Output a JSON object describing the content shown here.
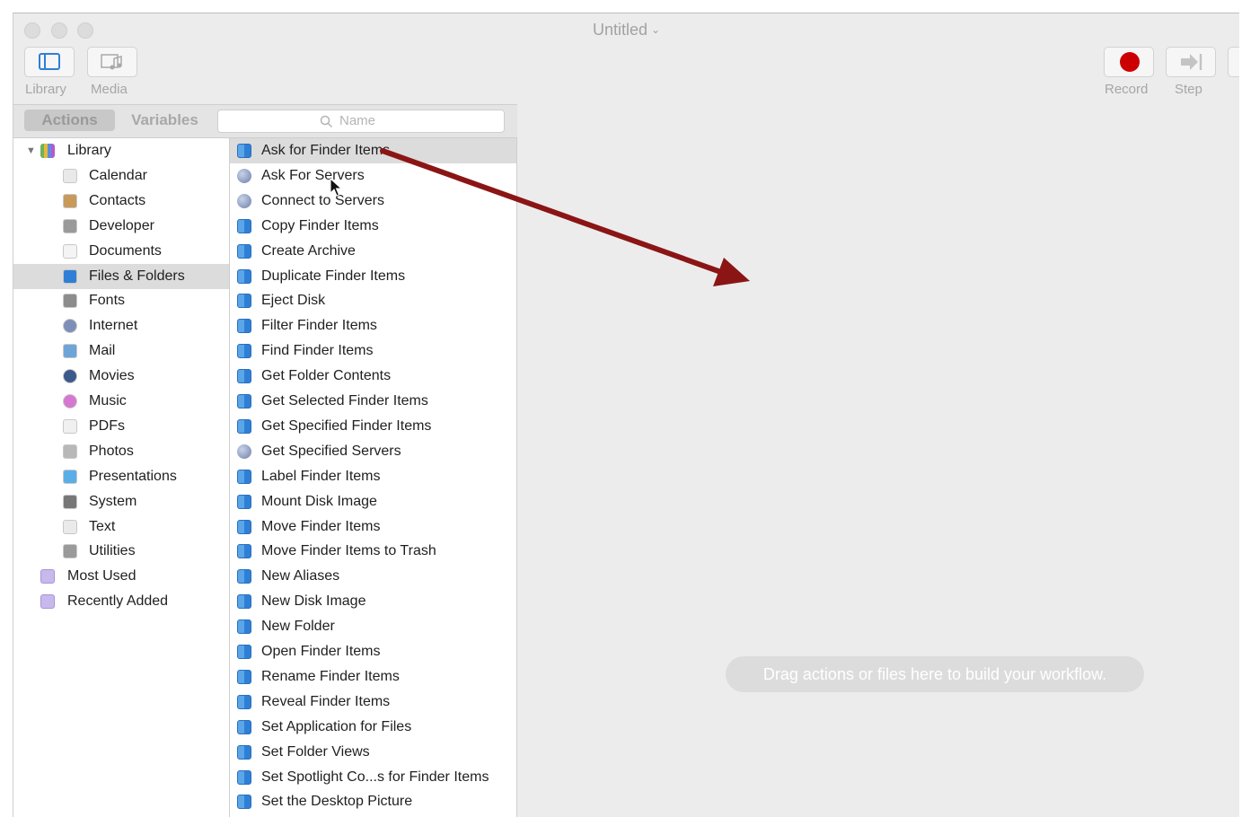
{
  "window": {
    "title": "Untitled"
  },
  "toolbar": {
    "library_label": "Library",
    "media_label": "Media",
    "record_label": "Record",
    "step_label": "Step"
  },
  "tabs": {
    "actions": "Actions",
    "variables": "Variables"
  },
  "search": {
    "placeholder": "Name"
  },
  "library": {
    "root": "Library",
    "items": [
      "Calendar",
      "Contacts",
      "Developer",
      "Documents",
      "Files & Folders",
      "Fonts",
      "Internet",
      "Mail",
      "Movies",
      "Music",
      "PDFs",
      "Photos",
      "Presentations",
      "System",
      "Text",
      "Utilities"
    ],
    "selected": "Files & Folders",
    "smart": [
      "Most Used",
      "Recently Added"
    ]
  },
  "actions": {
    "items": [
      {
        "label": "Ask for Finder Items",
        "icon": "finder"
      },
      {
        "label": "Ask For Servers",
        "icon": "globe"
      },
      {
        "label": "Connect to Servers",
        "icon": "globe"
      },
      {
        "label": "Copy Finder Items",
        "icon": "finder"
      },
      {
        "label": "Create Archive",
        "icon": "finder"
      },
      {
        "label": "Duplicate Finder Items",
        "icon": "finder"
      },
      {
        "label": "Eject Disk",
        "icon": "finder"
      },
      {
        "label": "Filter Finder Items",
        "icon": "finder"
      },
      {
        "label": "Find Finder Items",
        "icon": "finder"
      },
      {
        "label": "Get Folder Contents",
        "icon": "finder"
      },
      {
        "label": "Get Selected Finder Items",
        "icon": "finder"
      },
      {
        "label": "Get Specified Finder Items",
        "icon": "finder"
      },
      {
        "label": "Get Specified Servers",
        "icon": "globe"
      },
      {
        "label": "Label Finder Items",
        "icon": "finder"
      },
      {
        "label": "Mount Disk Image",
        "icon": "finder"
      },
      {
        "label": "Move Finder Items",
        "icon": "finder"
      },
      {
        "label": "Move Finder Items to Trash",
        "icon": "finder"
      },
      {
        "label": "New Aliases",
        "icon": "finder"
      },
      {
        "label": "New Disk Image",
        "icon": "finder"
      },
      {
        "label": "New Folder",
        "icon": "finder"
      },
      {
        "label": "Open Finder Items",
        "icon": "finder"
      },
      {
        "label": "Rename Finder Items",
        "icon": "finder"
      },
      {
        "label": "Reveal Finder Items",
        "icon": "finder"
      },
      {
        "label": "Set Application for Files",
        "icon": "finder"
      },
      {
        "label": "Set Folder Views",
        "icon": "finder"
      },
      {
        "label": "Set Spotlight Co...s for Finder Items",
        "icon": "finder"
      },
      {
        "label": "Set the Desktop Picture",
        "icon": "finder"
      }
    ],
    "selected": "Ask for Finder Items"
  },
  "workflow": {
    "hint": "Drag actions or files here to build your workflow."
  },
  "colors": {
    "record": "#cc0000",
    "arrow": "#8b1515",
    "finder_blue": "#2f7fd6"
  }
}
